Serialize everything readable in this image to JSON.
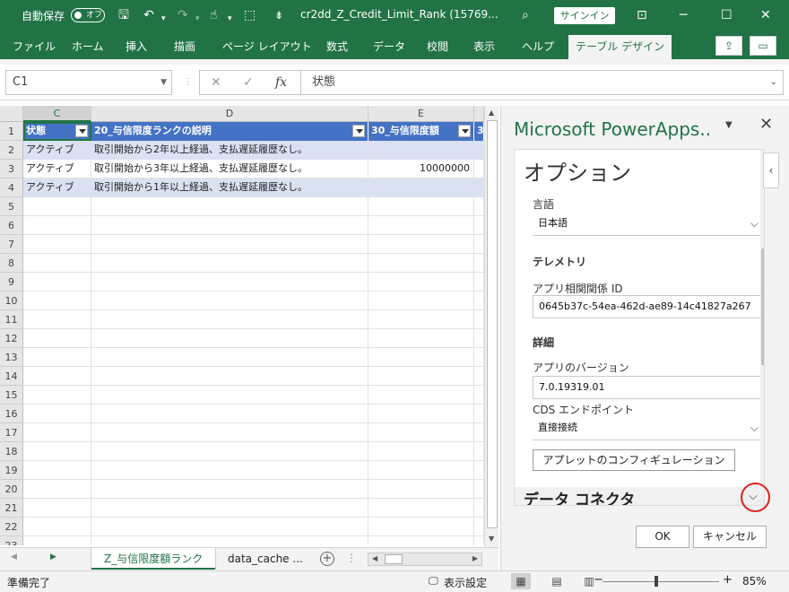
{
  "titlebar": {
    "autosave_label": "自動保存",
    "autosave_state": "オフ",
    "filename": "cr2dd_Z_Credit_Limit_Rank (15769...",
    "signin": "サインイン"
  },
  "ribbon": {
    "tabs": [
      "ファイル",
      "ホーム",
      "挿入",
      "描画",
      "ページ レイアウト",
      "数式",
      "データ",
      "校閲",
      "表示",
      "ヘルプ",
      "テーブル デザイン"
    ],
    "active_tab": "テーブル デザイン"
  },
  "formula_bar": {
    "name_box": "C1",
    "fx": "fx",
    "formula": "状態"
  },
  "grid": {
    "columns": [
      "C",
      "D",
      "E"
    ],
    "row_numbers": [
      "1",
      "2",
      "3",
      "4",
      "5",
      "6",
      "7",
      "8",
      "9",
      "10",
      "11",
      "12",
      "13",
      "14",
      "15",
      "16",
      "17",
      "18",
      "19",
      "20",
      "21",
      "22",
      "23"
    ],
    "header": [
      "状態",
      "20_与信限度ランクの説明",
      "30_与信限度額",
      "3"
    ],
    "rows": [
      [
        "アクティブ",
        "取引開始から2年以上経過、支払遅延履歴なし。",
        ""
      ],
      [
        "アクティブ",
        "取引開始から3年以上経過、支払遅延履歴なし。",
        "10000000"
      ],
      [
        "アクティブ",
        "取引開始から1年以上経過、支払遅延履歴なし。",
        ""
      ]
    ]
  },
  "sheets": {
    "tabs": [
      "Z_与信限度額ランク",
      "data_cache ..."
    ],
    "active": "Z_与信限度額ランク"
  },
  "statusbar": {
    "ready": "準備完了",
    "display_settings": "表示設定",
    "zoom": "85%"
  },
  "taskpane": {
    "title": "Microsoft PowerApps..",
    "options_heading": "オプション",
    "language_label": "言語",
    "language_value": "日本語",
    "telemetry_heading": "テレメトリ",
    "correlation_label": "アプリ相関関係 ID",
    "correlation_value": "0645b37c-54ea-462d-ae89-14c41827a267",
    "details_heading": "詳細",
    "version_label": "アプリのバージョン",
    "version_value": "7.0.19319.01",
    "cds_label": "CDS エンドポイント",
    "cds_value": "直接接続",
    "applet_config_button": "アプレットのコンフィギュレーション",
    "data_connector": "データ コネクタ",
    "ok": "OK",
    "cancel": "キャンセル"
  },
  "colors": {
    "excel_green": "#217346",
    "table_header": "#4472c4",
    "band_row": "#d9e1f2",
    "highlight_ring": "#e0201a"
  }
}
